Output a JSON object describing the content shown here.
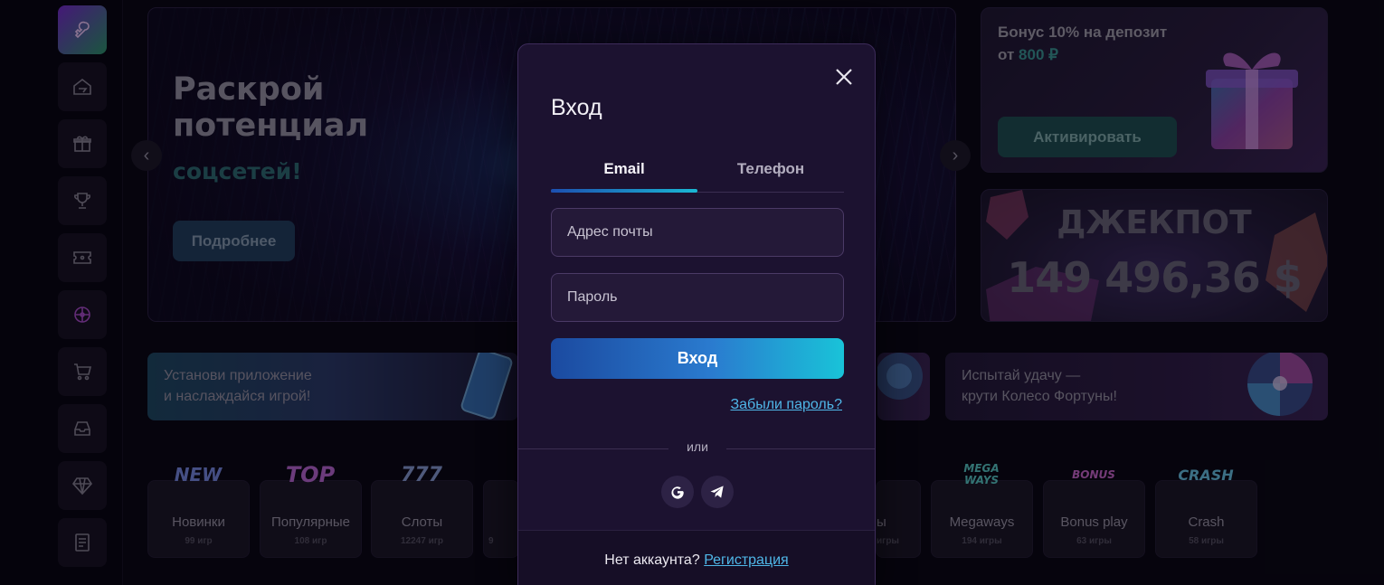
{
  "sidebar": {
    "items": [
      {
        "icon": "key-heart-icon",
        "active": true
      },
      {
        "icon": "home-icon"
      },
      {
        "icon": "gift-icon"
      },
      {
        "icon": "trophy-icon"
      },
      {
        "icon": "ticket-icon"
      },
      {
        "icon": "wheel-icon"
      },
      {
        "icon": "cart-icon"
      },
      {
        "icon": "inbox-icon"
      },
      {
        "icon": "diamond-icon"
      },
      {
        "icon": "document-icon"
      }
    ]
  },
  "hero": {
    "title_line1": "Раскрой",
    "title_line2": "потенциал",
    "accent": "соцсетей!",
    "button": "Подробнее"
  },
  "bonus": {
    "text_line1": "Бонус 10% на депозит",
    "text_prefix": "от",
    "amount": "800 ₽",
    "button": "Активировать"
  },
  "jackpot": {
    "label": "ДЖЕКПОТ",
    "value": "149 496,36 $"
  },
  "promos": {
    "app_line1": "Установи приложение",
    "app_line2": "и наслаждайся игрой!",
    "wheel_line1": "Испытай удачу —",
    "wheel_line2": "крути Колесо Фортуны!"
  },
  "categories": [
    {
      "icon_text": "NEW",
      "name": "Новинки",
      "count": "99 игр"
    },
    {
      "icon_text": "TOP",
      "name": "Популярные",
      "count": "108 игр"
    },
    {
      "icon_text": "777",
      "name": "Слоты",
      "count": "12247 игр"
    },
    {
      "icon_text": "",
      "name": "",
      "count": "9"
    },
    {
      "icon_text": "",
      "name": "ы",
      "count": "игры"
    },
    {
      "icon_text": "MEGA WAYS",
      "name": "Megaways",
      "count": "194 игры"
    },
    {
      "icon_text": "BONUS",
      "name": "Bonus play",
      "count": "63 игры"
    },
    {
      "icon_text": "CRASH",
      "name": "Crash",
      "count": "58 игры"
    }
  ],
  "modal": {
    "title": "Вход",
    "tabs": [
      "Email",
      "Телефон"
    ],
    "email_placeholder": "Адрес почты",
    "password_placeholder": "Пароль",
    "submit": "Вход",
    "forgot": "Забыли пароль?",
    "or": "или",
    "social": [
      "google-icon",
      "telegram-icon"
    ],
    "no_account": "Нет аккаунта?",
    "register": "Регистрация"
  },
  "colors": {
    "background": "#08060f",
    "modal_bg": "#1c1230",
    "link": "#4fb7e8",
    "button_gradient_start": "#1b4aa0",
    "button_gradient_end": "#19c3d8"
  }
}
